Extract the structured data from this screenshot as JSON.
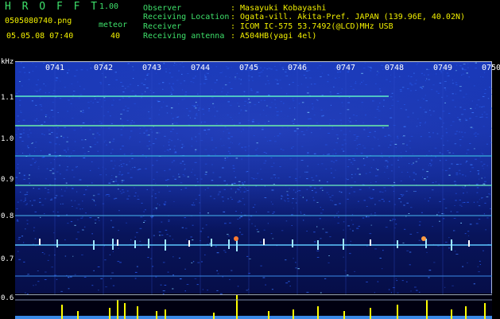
{
  "header": {
    "app_title": "H R O F F T",
    "app_version": "1.00",
    "file_name": "0505080740.png",
    "meteor_label": "meteor",
    "meteor_count": "40",
    "datetime": "05.05.08 07:40"
  },
  "station_info": [
    {
      "key": "Observer",
      "value": ": Masayuki Kobayashi"
    },
    {
      "key": "Receiving Location",
      "value": ": Ogata-vill. Akita-Pref. JAPAN (139.96E, 40.02N)"
    },
    {
      "key": "Receiver",
      "value": ": ICOM IC-575 53.7492(@LCD)MHz USB"
    },
    {
      "key": "Receiving antenna",
      "value": ": A504HB(yagi 4el)"
    }
  ],
  "spectrogram": {
    "unit_label": "kHz",
    "y_ticks": [
      "1.1",
      "1.0",
      "0.9",
      "0.8",
      "0.7",
      "0.6"
    ],
    "time_labels": [
      "0741",
      "0742",
      "0743",
      "0744",
      "0745",
      "0746",
      "0747",
      "0748",
      "0749",
      "0750"
    ],
    "colors": {
      "labels": "#3ee06a",
      "values": "#f2f000",
      "trace": "#ffff00"
    }
  }
}
